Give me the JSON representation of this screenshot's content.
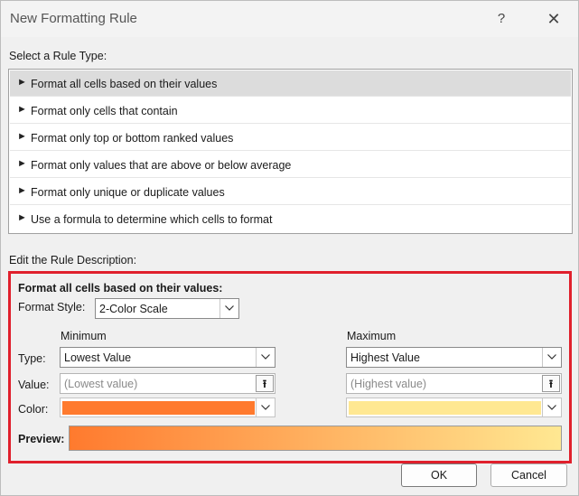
{
  "window": {
    "title": "New Formatting Rule",
    "help_label": "?",
    "close_label": "✕"
  },
  "rule_type": {
    "label": "Select a Rule Type:",
    "selected_index": 0,
    "items": [
      {
        "label": "Format all cells based on their values"
      },
      {
        "label": "Format only cells that contain"
      },
      {
        "label": "Format only top or bottom ranked values"
      },
      {
        "label": "Format only values that are above or below average"
      },
      {
        "label": "Format only unique or duplicate values"
      },
      {
        "label": "Use a formula to determine which cells to format"
      }
    ],
    "bullet": "►"
  },
  "description": {
    "label": "Edit the Rule Description:",
    "heading": "Format all cells based on their values:",
    "format_style_label": "Format Style:",
    "format_style_value": "2-Color Scale",
    "minimum_header": "Minimum",
    "maximum_header": "Maximum",
    "type_label": "Type:",
    "value_label": "Value:",
    "color_label": "Color:",
    "min_type": "Lowest Value",
    "max_type": "Highest Value",
    "min_value_placeholder": "(Lowest value)",
    "max_value_placeholder": "(Highest value)",
    "min_color": "#ff7a2e",
    "max_color": "#ffe892",
    "preview_label": "Preview:",
    "highlight_color": "#e0202c"
  },
  "buttons": {
    "ok": "OK",
    "cancel": "Cancel"
  },
  "icons": {
    "picker": "upload-arrow-icon",
    "dropdown": "chevron-down-icon"
  }
}
